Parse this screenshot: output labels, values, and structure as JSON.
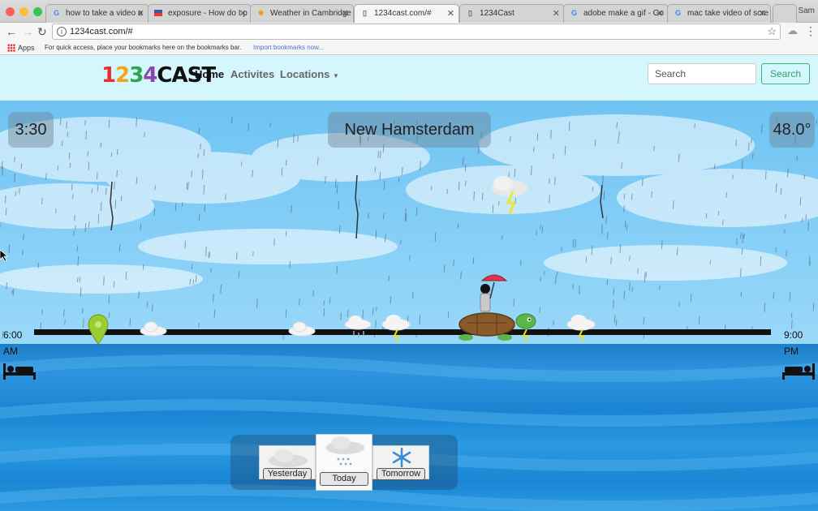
{
  "browser": {
    "tabs": [
      {
        "title": "how to take a video o",
        "icon": "google-icon"
      },
      {
        "title": "exposure - How do I p",
        "icon": "flag-icon"
      },
      {
        "title": "Weather in Cambridge",
        "icon": "weather-icon"
      },
      {
        "title": "1234cast.com/#",
        "icon": "page-icon",
        "active": true
      },
      {
        "title": "1234Cast",
        "icon": "page-icon"
      },
      {
        "title": "adobe make a gif - Go",
        "icon": "google-icon"
      },
      {
        "title": "mac take video of scre",
        "icon": "google-icon"
      }
    ],
    "profile_name": "Sam",
    "url": "1234cast.com/#",
    "bookmarks": {
      "apps_label": "Apps",
      "hint": "For quick access, place your bookmarks here on the bookmarks bar.",
      "import_link": "Import bookmarks now..."
    }
  },
  "site": {
    "logo_text": "1234CAST",
    "nav": {
      "home": "Home",
      "activities": "Activites",
      "locations": "Locations"
    },
    "search": {
      "placeholder": "Search",
      "button": "Search"
    }
  },
  "scene": {
    "time": "3:30",
    "location": "New Hamsterdam",
    "temperature": "48.0°",
    "timeline": {
      "start_time": "6:00",
      "start_period": "AM",
      "end_time": "9:00",
      "end_period": "PM"
    },
    "forecast_days": [
      {
        "label": "Yesterday",
        "icon": "cloud-icon"
      },
      {
        "label": "Today",
        "icon": "rain-cloud-icon",
        "selected": true
      },
      {
        "label": "Tomorrow",
        "icon": "snowflake-icon"
      }
    ]
  },
  "colors": {
    "nav_background": "#d4f6fd",
    "search_button": "#3cb371",
    "sky": "#87d0f7",
    "water": "#1f86d4"
  }
}
